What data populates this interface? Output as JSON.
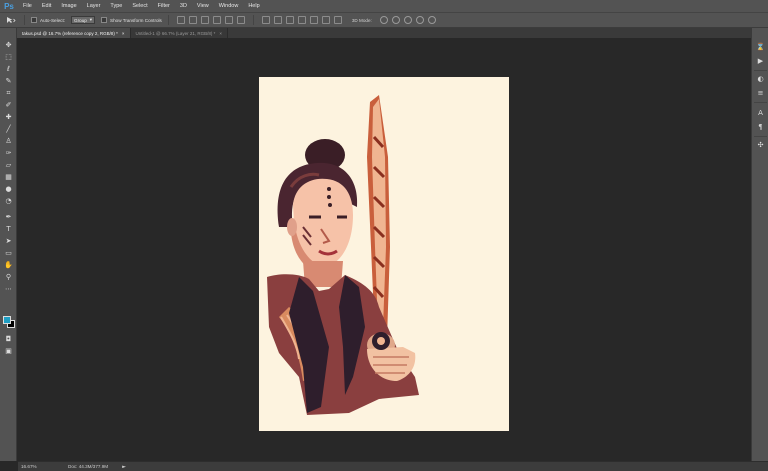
{
  "app": {
    "logo": "Ps"
  },
  "menu": [
    "File",
    "Edit",
    "Image",
    "Layer",
    "Type",
    "Select",
    "Filter",
    "3D",
    "View",
    "Window",
    "Help"
  ],
  "options": {
    "auto_select_label": "Auto-Select:",
    "auto_select_value": "Group",
    "show_transform_label": "Show Transform Controls",
    "mode_3d_label": "3D Mode:"
  },
  "tabs": [
    {
      "label": "takus.psd @ 16.7% (reference copy 2, RGB/8) *",
      "active": true
    },
    {
      "label": "Untitled-1 @ 66.7% (Layer 21, RGB/8) *",
      "active": false
    }
  ],
  "tab_close": "×",
  "status": {
    "zoom": "16.67%",
    "doc": "Doc: 44.3M/377.9M",
    "arrow": "►"
  },
  "colors": {
    "foreground": "#1f9ec3",
    "background": "#000000",
    "canvas": "#fdf3df",
    "workspace": "#282828"
  },
  "tools": [
    "move-tool-icon",
    "marquee-tool-icon",
    "lasso-tool-icon",
    "quick-select-tool-icon",
    "crop-tool-icon",
    "eyedropper-tool-icon",
    "healing-brush-tool-icon",
    "brush-tool-icon",
    "clone-stamp-tool-icon",
    "history-brush-tool-icon",
    "eraser-tool-icon",
    "gradient-tool-icon",
    "blur-tool-icon",
    "dodge-tool-icon",
    "pen-tool-icon",
    "type-tool-icon",
    "path-select-tool-icon",
    "rectangle-tool-icon",
    "hand-tool-icon",
    "zoom-tool-icon"
  ]
}
